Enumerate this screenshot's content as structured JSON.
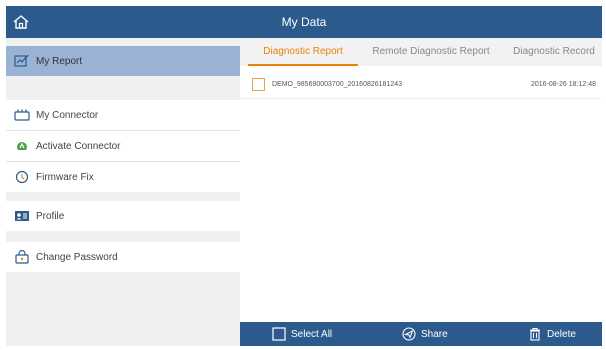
{
  "header": {
    "title": "My Data",
    "home_icon": "home-icon"
  },
  "sidebar": {
    "items": [
      {
        "label": "My Report",
        "icon": "report-icon",
        "active": true
      },
      {
        "label": "My Connector",
        "icon": "connector-icon"
      },
      {
        "label": "Activate Connector",
        "icon": "activate-connector-icon"
      },
      {
        "label": "Firmware Fix",
        "icon": "firmware-fix-icon"
      },
      {
        "label": "Profile",
        "icon": "profile-icon"
      },
      {
        "label": "Change Password",
        "icon": "change-password-icon"
      }
    ]
  },
  "tabs": [
    {
      "label": "Diagnostic Report",
      "active": true
    },
    {
      "label": "Remote Diagnostic Report"
    },
    {
      "label": "Diagnostic Record"
    }
  ],
  "reports": [
    {
      "name": "DEMO_985690003700_20160826181243",
      "date": "2016-08-26 18:12:48",
      "checked": false
    }
  ],
  "bottom_bar": {
    "select_all": "Select All",
    "share": "Share",
    "delete": "Delete"
  },
  "colors": {
    "header": "#2d5a8c",
    "accent": "#e8820c",
    "active_item": "#9ab3d5"
  }
}
